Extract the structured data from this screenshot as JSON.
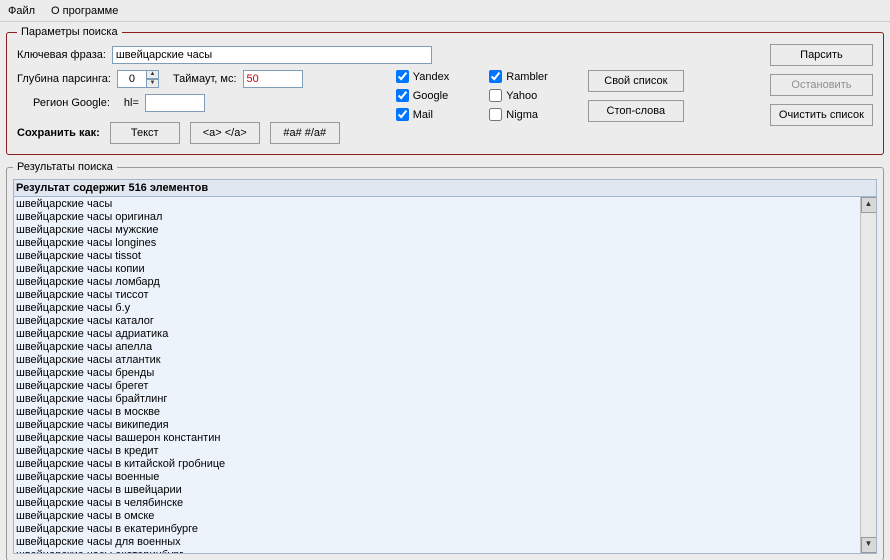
{
  "menu": {
    "file": "Файл",
    "about": "О программе"
  },
  "params": {
    "legend": "Параметры поиска",
    "keyphrase_label": "Ключевая фраза:",
    "keyphrase_value": "швейцарские часы",
    "depth_label": "Глубина парсинга:",
    "depth_value": "0",
    "timeout_label": "Таймаут, мс:",
    "timeout_value": "50",
    "region_label": "Регион Google:",
    "hl_label": "hl=",
    "hl_value": "",
    "save_label": "Сохранить как:",
    "btn_text": "Текст",
    "btn_a": "<a> </a>",
    "btn_hash": "#a# #/a#",
    "engines": {
      "yandex": "Yandex",
      "google": "Google",
      "mail": "Mail",
      "rambler": "Rambler",
      "yahoo": "Yahoo",
      "nigma": "Nigma"
    },
    "engine_state": {
      "yandex": true,
      "google": true,
      "mail": true,
      "rambler": true,
      "yahoo": false,
      "nigma": false
    },
    "btn_ownlist": "Свой список",
    "btn_stopwords": "Стоп-слова",
    "btn_parse": "Парсить",
    "btn_stop": "Остановить",
    "btn_clear": "Очистить список"
  },
  "results": {
    "legend": "Результаты поиска",
    "caption": "Результат содержит 516 элементов",
    "items": [
      "швейцарские часы",
      "швейцарские часы оригинал",
      "швейцарские часы мужские",
      "швейцарские часы longines",
      "швейцарские часы tissot",
      "швейцарские часы копии",
      "швейцарские часы ломбард",
      "швейцарские часы тиссот",
      "швейцарские часы б.у",
      "швейцарские часы каталог",
      "швейцарские часы адриатика",
      "швейцарские часы апелла",
      "швейцарские часы атлантик",
      "швейцарские часы бренды",
      "швейцарские часы брегет",
      "швейцарские часы брайтлинг",
      "швейцарские часы в москве",
      "швейцарские часы википедия",
      "швейцарские часы вашерон константин",
      "швейцарские часы в кредит",
      "швейцарские часы в китайской гробнице",
      "швейцарские часы военные",
      "швейцарские часы в швейцарии",
      "швейцарские часы в челябинске",
      "швейцарские часы в омске",
      "швейцарские часы в екатеринбурге",
      "швейцарские часы для военных",
      "швейцарские часы екатеринбург"
    ]
  }
}
